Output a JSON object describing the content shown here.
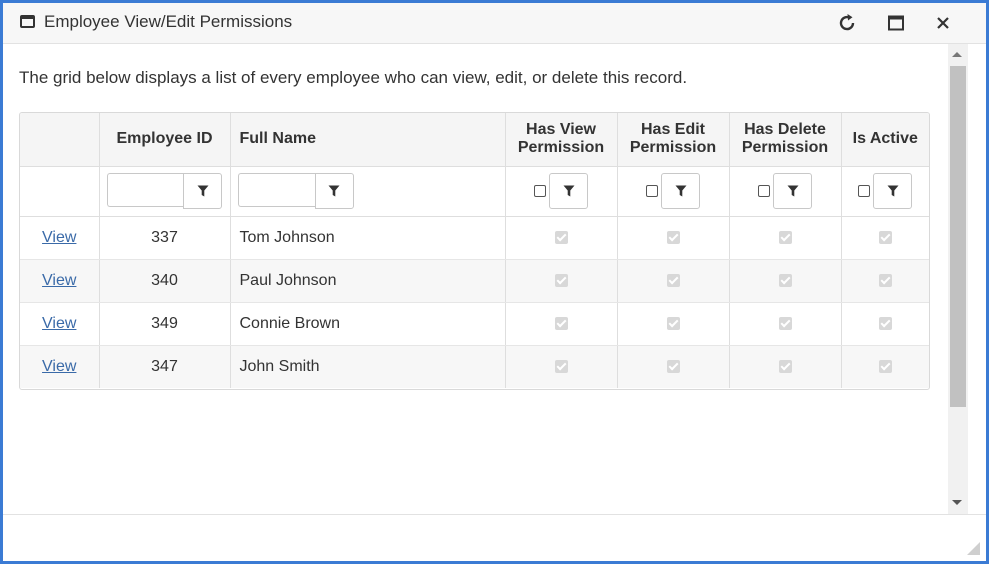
{
  "window": {
    "title": "Employee View/Edit Permissions",
    "icons": {
      "window": "window-icon",
      "refresh": "refresh-icon",
      "maximize": "maximize-icon",
      "close": "close-icon"
    }
  },
  "description": "The grid below displays a list of every employee who can view, edit, or delete this record.",
  "grid": {
    "columns": [
      {
        "line1": "",
        "line2": ""
      },
      {
        "line1": "Employee ID",
        "line2": ""
      },
      {
        "line1": "Full Name",
        "line2": ""
      },
      {
        "line1": "Has View",
        "line2": "Permission"
      },
      {
        "line1": "Has Edit",
        "line2": "Permission"
      },
      {
        "line1": "Has Delete",
        "line2": "Permission"
      },
      {
        "line1": "Is Active",
        "line2": ""
      }
    ],
    "filter_icon": "filter-icon",
    "rows": [
      {
        "link": "View",
        "employee_id": "337",
        "full_name": "Tom Johnson",
        "view": true,
        "edit": true,
        "delete": true,
        "active": true
      },
      {
        "link": "View",
        "employee_id": "340",
        "full_name": "Paul Johnson",
        "view": true,
        "edit": true,
        "delete": true,
        "active": true
      },
      {
        "link": "View",
        "employee_id": "349",
        "full_name": "Connie Brown",
        "view": true,
        "edit": true,
        "delete": true,
        "active": true
      },
      {
        "link": "View",
        "employee_id": "347",
        "full_name": "John Smith",
        "view": true,
        "edit": true,
        "delete": true,
        "active": true
      }
    ]
  },
  "colors": {
    "border": "#3b7bd4",
    "link": "#3a6aa8"
  }
}
